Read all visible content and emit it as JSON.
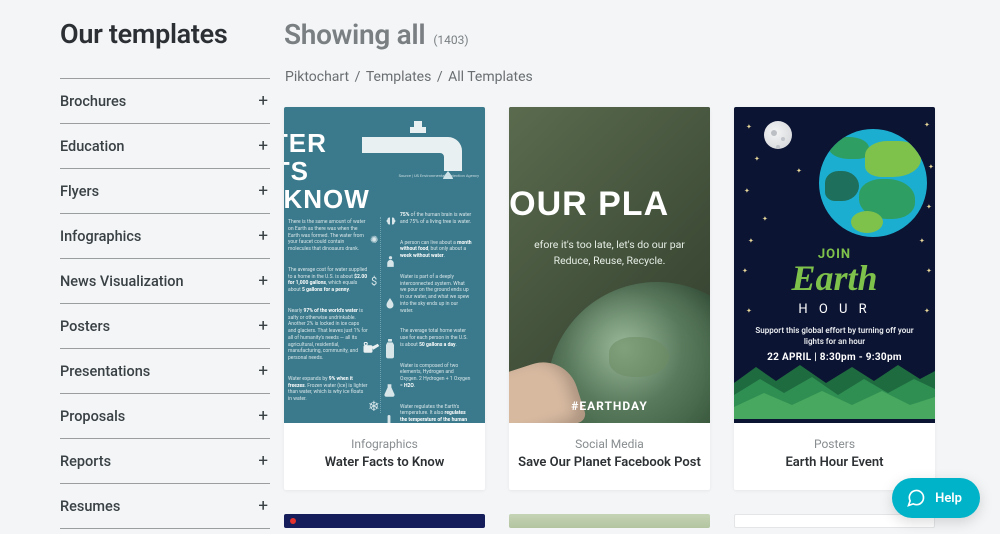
{
  "sidebar": {
    "title": "Our templates",
    "items": [
      {
        "label": "Brochures"
      },
      {
        "label": "Education"
      },
      {
        "label": "Flyers"
      },
      {
        "label": "Infographics"
      },
      {
        "label": "News Visualization"
      },
      {
        "label": "Posters"
      },
      {
        "label": "Presentations"
      },
      {
        "label": "Proposals"
      },
      {
        "label": "Reports"
      },
      {
        "label": "Resumes"
      }
    ]
  },
  "header": {
    "title": "Showing all",
    "count": "(1403)"
  },
  "breadcrumb": {
    "a": "Piktochart",
    "b": "Templates",
    "c": "All Templates",
    "sep": "/"
  },
  "cards": [
    {
      "category": "Infographics",
      "title": "Water Facts to Know",
      "preview": {
        "bigline1": "ATER",
        "bigline2": "CTS",
        "bigline3": "O KNOW",
        "source": "Source | US Environmental Protection Agency"
      }
    },
    {
      "category": "Social Media",
      "title": "Save Our Planet Facebook Post",
      "preview": {
        "headline": "E OUR PLA",
        "sub1": "efore it's too late, let's do our par",
        "sub2": "Reduce, Reuse, Recycle.",
        "hashtag": "#EARTHDAY"
      }
    },
    {
      "category": "Posters",
      "title": "Earth Hour Event",
      "preview": {
        "join": "JOIN",
        "earth": "Earth",
        "hour": "H O U R",
        "support": "Support this global effort by turning off your lights for an hour",
        "date": "22 APRIL  |  8:30pm - 9:30pm"
      }
    }
  ],
  "help": {
    "label": "Help"
  }
}
